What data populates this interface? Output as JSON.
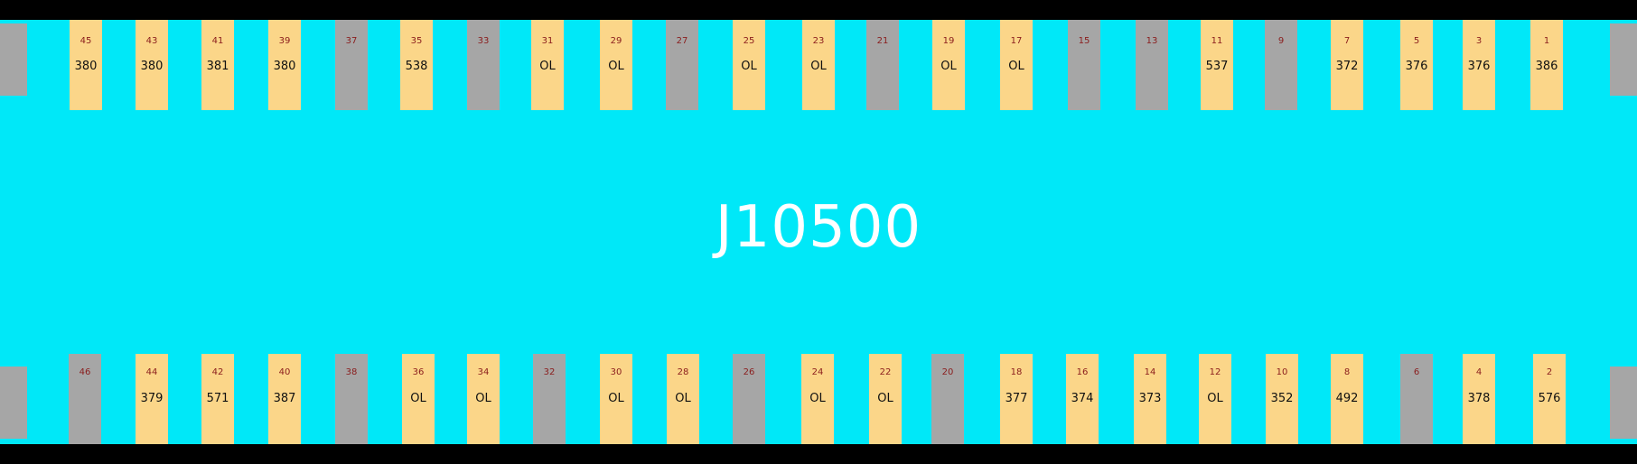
{
  "component_label": "J10500",
  "colors": {
    "board": "#00e8f8",
    "active_pad": "#fbd689",
    "inactive_pad": "#a6a6a6",
    "pin_number": "#8a1c1c",
    "value": "#111111"
  },
  "top_pins": [
    {
      "pin": "45",
      "value": "380",
      "active": true
    },
    {
      "pin": "43",
      "value": "380",
      "active": true
    },
    {
      "pin": "41",
      "value": "381",
      "active": true
    },
    {
      "pin": "39",
      "value": "380",
      "active": true
    },
    {
      "pin": "37",
      "value": "",
      "active": false
    },
    {
      "pin": "35",
      "value": "538",
      "active": true
    },
    {
      "pin": "33",
      "value": "",
      "active": false
    },
    {
      "pin": "31",
      "value": "OL",
      "active": true
    },
    {
      "pin": "29",
      "value": "OL",
      "active": true
    },
    {
      "pin": "27",
      "value": "",
      "active": false
    },
    {
      "pin": "25",
      "value": "OL",
      "active": true
    },
    {
      "pin": "23",
      "value": "OL",
      "active": true
    },
    {
      "pin": "21",
      "value": "",
      "active": false
    },
    {
      "pin": "19",
      "value": "OL",
      "active": true
    },
    {
      "pin": "17",
      "value": "OL",
      "active": true
    },
    {
      "pin": "15",
      "value": "",
      "active": false
    },
    {
      "pin": "13",
      "value": "",
      "active": false
    },
    {
      "pin": "11",
      "value": "537",
      "active": true
    },
    {
      "pin": "9",
      "value": "",
      "active": false
    },
    {
      "pin": "7",
      "value": "372",
      "active": true
    },
    {
      "pin": "5",
      "value": "376",
      "active": true
    },
    {
      "pin": "3",
      "value": "376",
      "active": true
    },
    {
      "pin": "1",
      "value": "386",
      "active": true
    }
  ],
  "bottom_pins": [
    {
      "pin": "46",
      "value": "",
      "active": false
    },
    {
      "pin": "44",
      "value": "379",
      "active": true
    },
    {
      "pin": "42",
      "value": "571",
      "active": true
    },
    {
      "pin": "40",
      "value": "387",
      "active": true
    },
    {
      "pin": "38",
      "value": "",
      "active": false
    },
    {
      "pin": "36",
      "value": "OL",
      "active": true
    },
    {
      "pin": "34",
      "value": "OL",
      "active": true
    },
    {
      "pin": "32",
      "value": "",
      "active": false
    },
    {
      "pin": "30",
      "value": "OL",
      "active": true
    },
    {
      "pin": "28",
      "value": "OL",
      "active": true
    },
    {
      "pin": "26",
      "value": "",
      "active": false
    },
    {
      "pin": "24",
      "value": "OL",
      "active": true
    },
    {
      "pin": "22",
      "value": "OL",
      "active": true
    },
    {
      "pin": "20",
      "value": "",
      "active": false
    },
    {
      "pin": "18",
      "value": "377",
      "active": true
    },
    {
      "pin": "16",
      "value": "374",
      "active": true
    },
    {
      "pin": "14",
      "value": "373",
      "active": true
    },
    {
      "pin": "12",
      "value": "OL",
      "active": true
    },
    {
      "pin": "10",
      "value": "352",
      "active": true
    },
    {
      "pin": "8",
      "value": "492",
      "active": true
    },
    {
      "pin": "6",
      "value": "",
      "active": false
    },
    {
      "pin": "4",
      "value": "378",
      "active": true
    },
    {
      "pin": "2",
      "value": "576",
      "active": true
    }
  ]
}
